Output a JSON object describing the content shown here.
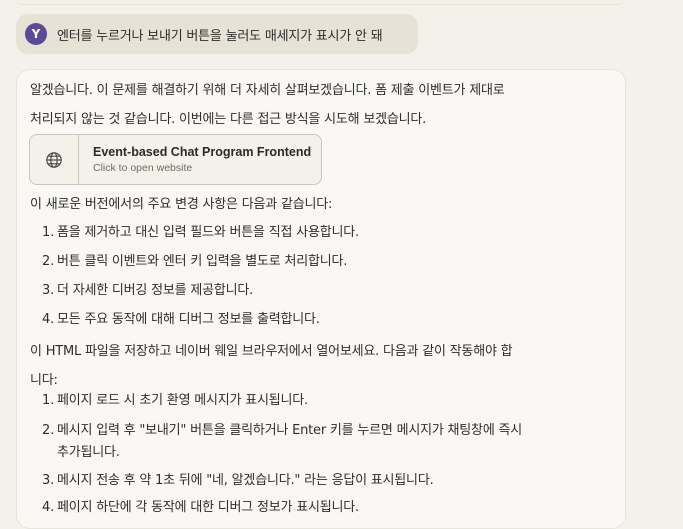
{
  "user_message": {
    "avatar_letter": "Y",
    "text": "엔터를 누르거나 보내기 버튼을 눌러도 매세지가 표시가 안 돼"
  },
  "assistant": {
    "intro_line1": "알겠습니다. 이 문제를 해결하기 위해 더 자세히 살펴보겠습니다. 폼 제출 이벤트가 제대로",
    "intro_line2": "처리되지 않는 것 같습니다. 이번에는 다른 접근 방식을 시도해 보겠습니다.",
    "artifact": {
      "title": "Event-based Chat Program Frontend",
      "subtitle": "Click to open website",
      "icon": "globe-icon"
    },
    "changes_heading": "이 새로운 버전에서의 주요 변경 사항은 다음과 같습니다:",
    "changes": [
      {
        "num": "1.",
        "text": "폼을 제거하고 대신 입력 필드와 버튼을 직접 사용합니다."
      },
      {
        "num": "2.",
        "text": "버튼 클릭 이벤트와 엔터 키 입력을 별도로 처리합니다."
      },
      {
        "num": "3.",
        "text": "더 자세한 디버깅 정보를 제공합니다."
      },
      {
        "num": "4.",
        "text": "모든 주요 동작에 대해 디버그 정보를 출력합니다."
      }
    ],
    "usage_line1": "이 HTML 파일을 저장하고 네이버 웨일 브라우저에서 열어보세요. 다음과 같이 작동해야 합",
    "usage_line2": "니다:",
    "steps": [
      {
        "num": "1.",
        "text": "페이지 로드 시 초기 환영 메시지가 표시됩니다."
      },
      {
        "num": "2.",
        "text": "메시지 입력 후 \"보내기\" 버튼을 클릭하거나 Enter 키를 누르면 메시지가 채팅창에 즉시",
        "text2": "추가됩니다."
      },
      {
        "num": "3.",
        "text": "메시지 전송 후 약 1초 뒤에 \"네, 알겠습니다.\" 라는 응답이 표시됩니다."
      },
      {
        "num": "4.",
        "text": "페이지 하단에 각 동작에 대한 디버그 정보가 표시됩니다."
      }
    ]
  }
}
